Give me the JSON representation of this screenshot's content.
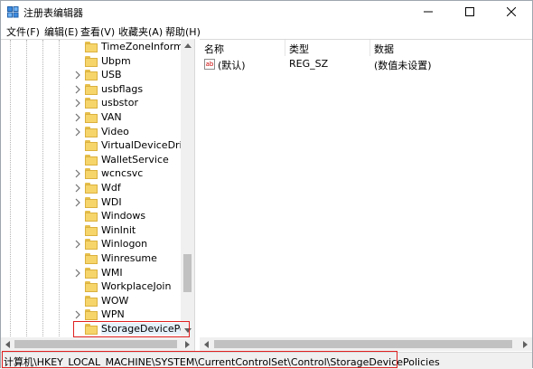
{
  "window": {
    "title": "注册表编辑器",
    "controls": [
      "minimize",
      "maximize",
      "close"
    ]
  },
  "menu": [
    {
      "label": "文件(F)"
    },
    {
      "label": "编辑(E)"
    },
    {
      "label": "查看(V)"
    },
    {
      "label": "收藏夹(A)"
    },
    {
      "label": "帮助(H)"
    }
  ],
  "tree": {
    "items": [
      {
        "label": "TimeZoneInformatic",
        "expandable": false
      },
      {
        "label": "Ubpm",
        "expandable": false
      },
      {
        "label": "USB",
        "expandable": true
      },
      {
        "label": "usbflags",
        "expandable": true
      },
      {
        "label": "usbstor",
        "expandable": true
      },
      {
        "label": "VAN",
        "expandable": true
      },
      {
        "label": "Video",
        "expandable": true
      },
      {
        "label": "VirtualDeviceDrivers",
        "expandable": false
      },
      {
        "label": "WalletService",
        "expandable": false
      },
      {
        "label": "wcncsvc",
        "expandable": true
      },
      {
        "label": "Wdf",
        "expandable": true
      },
      {
        "label": "WDI",
        "expandable": true
      },
      {
        "label": "Windows",
        "expandable": false
      },
      {
        "label": "WinInit",
        "expandable": false
      },
      {
        "label": "Winlogon",
        "expandable": true
      },
      {
        "label": "Winresume",
        "expandable": false
      },
      {
        "label": "WMI",
        "expandable": true
      },
      {
        "label": "WorkplaceJoin",
        "expandable": false
      },
      {
        "label": "WOW",
        "expandable": false
      },
      {
        "label": "WPN",
        "expandable": true
      },
      {
        "label": "StorageDevicePolicie",
        "expandable": false,
        "new_key": true
      }
    ]
  },
  "list": {
    "columns": {
      "name": "名称",
      "type": "类型",
      "data": "数据"
    },
    "rows": [
      {
        "name": "(默认)",
        "type": "REG_SZ",
        "data": "(数值未设置)",
        "icon": "string-value-icon"
      }
    ]
  },
  "status": {
    "path": "计算机\\HKEY_LOCAL_MACHINE\\SYSTEM\\CurrentControlSet\\Control\\StorageDevicePolicies"
  },
  "colors": {
    "highlight_box": "#e02020",
    "folder": "#f6d56b",
    "selection": "#e5f1fb"
  }
}
